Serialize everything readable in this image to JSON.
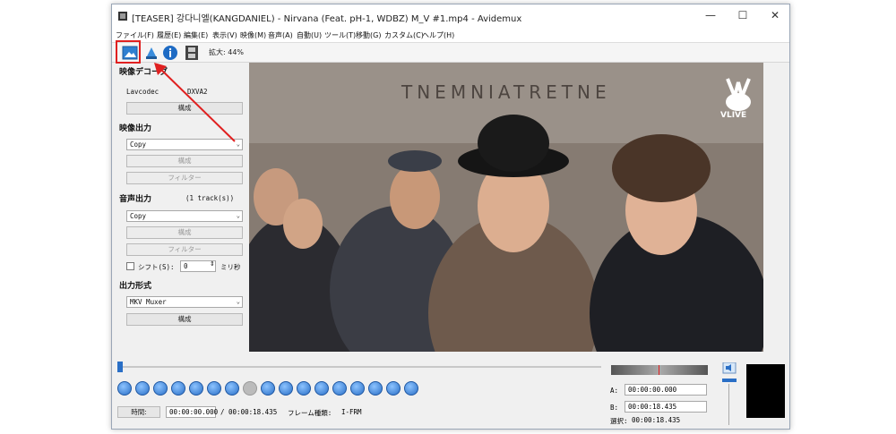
{
  "window": {
    "title": "[TEASER] 강다니엘(KANGDANIEL) - Nirvana (Feat. pH-1, WDBZ) M_V #1.mp4 - Avidemux",
    "minimize": "—",
    "maximize": "☐",
    "close": "✕"
  },
  "menu": [
    "ファイル(F)",
    "履歴(E)",
    "編集(E)",
    "表示(V)",
    "映像(M)",
    "音声(A)",
    "自動(U)",
    "ツール(T)",
    "移動(G)",
    "カスタム(C)",
    "ヘルプ(H)"
  ],
  "toolbar": {
    "zoom_label": "拡大: 44%",
    "icons": [
      "image-icon",
      "save-icon",
      "info-icon",
      "film-icon"
    ]
  },
  "sidebar": {
    "video_decoder": {
      "heading": "映像デコーダ",
      "decoder_left": "Lavcodec",
      "decoder_right": "DXVA2",
      "configure": "構成"
    },
    "video_output": {
      "heading": "映像出力",
      "codec": "Copy",
      "configure": "構成",
      "filters": "フィルター"
    },
    "audio_output": {
      "heading": "音声出力",
      "tracks": "(1 track(s))",
      "codec": "Copy",
      "configure": "構成",
      "filters": "フィルター",
      "shift_label": "シフト(S):",
      "shift_value": "0",
      "shift_unit": "ミリ秒"
    },
    "output_format": {
      "heading": "出力形式",
      "muxer": "MKV Muxer",
      "configure": "構成"
    }
  },
  "video": {
    "wall_text": "TNEMNIATRETNE",
    "logo_text": "VLIVE"
  },
  "playback": {
    "time_button": "時間:",
    "current_time": "00:00:00.000",
    "total_time": "/ 00:00:18.435",
    "frame_type_label": "フレーム種類:",
    "frame_type": "I-FRM"
  },
  "selection": {
    "a_label": "A:",
    "a_value": "00:00:00.000",
    "b_label": "B:",
    "b_value": "00:00:18.435",
    "sel_label": "選択:",
    "sel_value": "00:00:18.435"
  },
  "colors": {
    "highlight": "#e02020",
    "accent": "#2a6fc6"
  }
}
